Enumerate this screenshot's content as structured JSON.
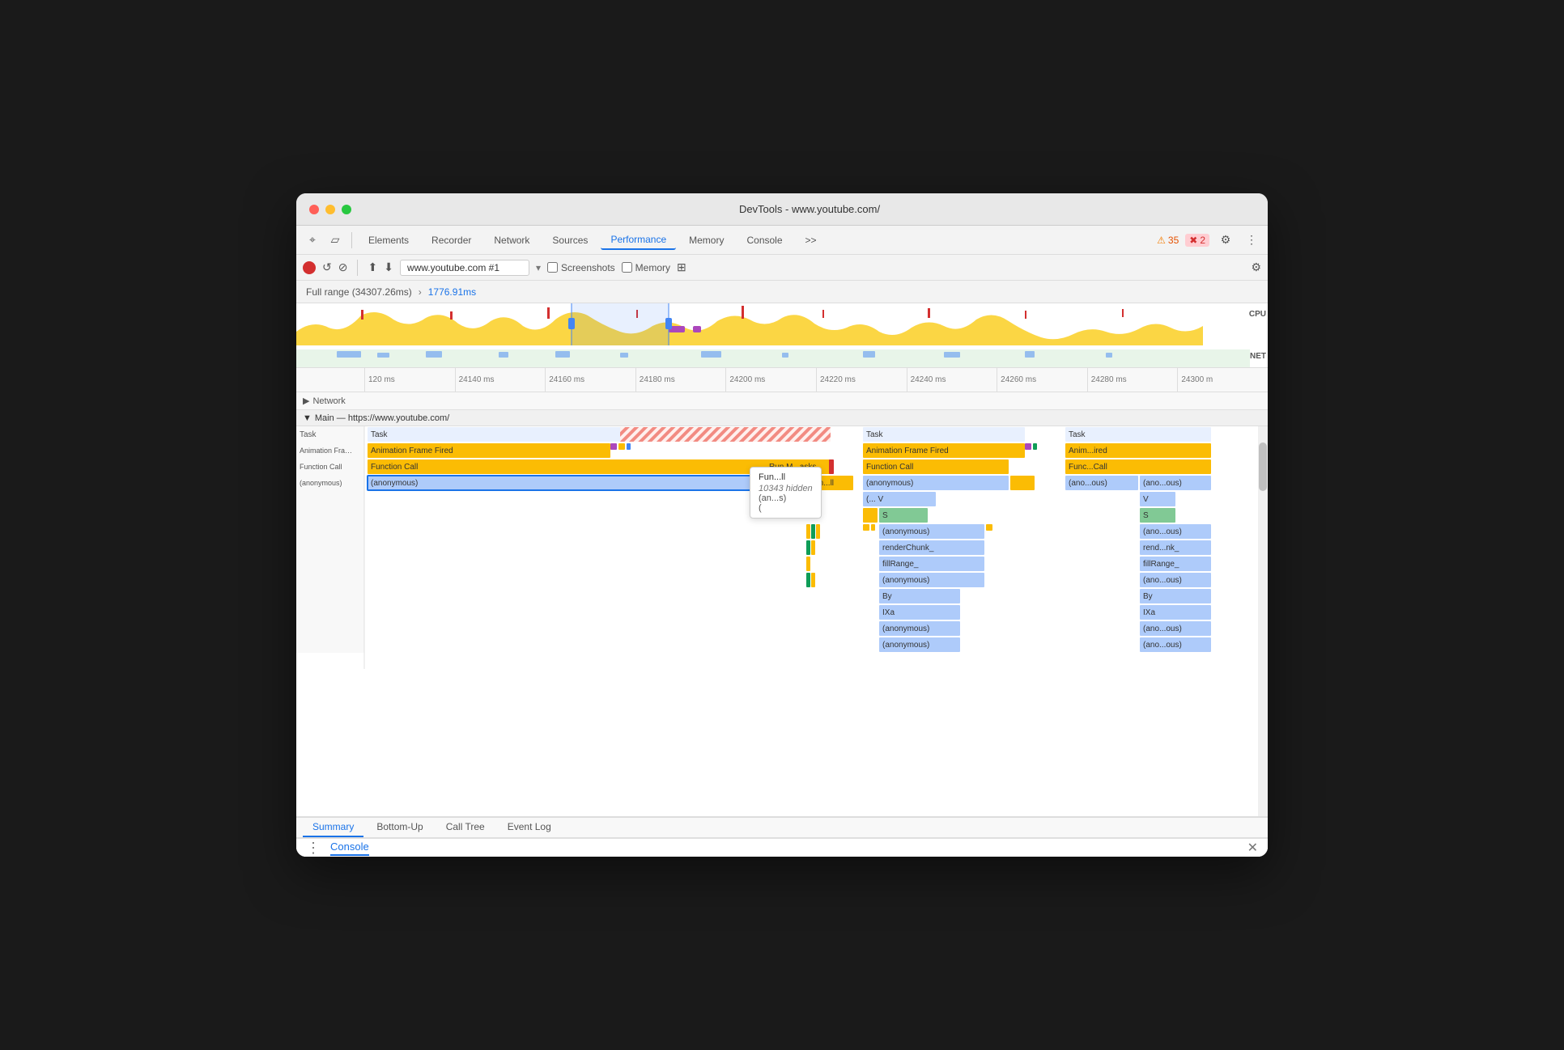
{
  "window": {
    "title": "DevTools - www.youtube.com/"
  },
  "toolbar": {
    "tabs": [
      "Elements",
      "Recorder",
      "Network",
      "Sources",
      "Performance",
      "Memory",
      "Console",
      "more"
    ],
    "active_tab": "Performance",
    "warn_count": "35",
    "error_count": "2"
  },
  "toolbar2": {
    "url": "www.youtube.com #1",
    "screenshots_label": "Screenshots",
    "memory_label": "Memory"
  },
  "range": {
    "full_range": "Full range (34307.26ms)",
    "selected": "1776.91ms",
    "chevron": "›"
  },
  "ruler": {
    "marks": [
      "120 ms",
      "24140 ms",
      "24160 ms",
      "24180 ms",
      "24200 ms",
      "24220 ms",
      "24240 ms",
      "24260 ms",
      "24280 ms",
      "24300 m"
    ]
  },
  "network_row": {
    "label": "Network"
  },
  "main": {
    "header": "Main — https://www.youtube.com/",
    "rows": [
      {
        "label": "Task",
        "items": [
          "Task",
          "Task"
        ]
      },
      {
        "label": "Animation Frame Fired",
        "items": [
          "Animation Frame Fired",
          "Animation Frame Fired",
          "Anim...ired"
        ]
      },
      {
        "label": "Function Call",
        "items": [
          "Function Call",
          "Run M...asks",
          "Function Call",
          "Func...Call"
        ]
      },
      {
        "label": "(anonymous)",
        "items": [
          "(anonymous)",
          "Fun...ll",
          "(anonymous)",
          "(anonymous)",
          "(ano...ous)",
          "(ano...ous)"
        ]
      },
      {
        "label": "",
        "items": [
          "10343 hidden"
        ]
      },
      {
        "label": "",
        "items": [
          "(an...s)",
          "(... V",
          "V"
        ]
      },
      {
        "label": "",
        "items": [
          "(...",
          "S",
          "S"
        ]
      },
      {
        "label": "",
        "items": [
          "(anonymous)",
          "(ano...ous)"
        ]
      },
      {
        "label": "",
        "items": [
          "renderChunk_",
          "rend...nk_"
        ]
      },
      {
        "label": "",
        "items": [
          "fillRange_",
          "fillRange_"
        ]
      },
      {
        "label": "",
        "items": [
          "(anonymous)",
          "(ano...ous)"
        ]
      },
      {
        "label": "",
        "items": [
          "By",
          "By"
        ]
      },
      {
        "label": "",
        "items": [
          "IXa",
          "IXa"
        ]
      },
      {
        "label": "",
        "items": [
          "(anonymous)",
          "(ano...ous)"
        ]
      },
      {
        "label": "",
        "items": [
          "(anonymous)",
          "(ano...ous)"
        ]
      }
    ]
  },
  "tooltip": {
    "header": "Fun...ll",
    "hidden_text": "10343 hidden",
    "sub1": "(an...s)",
    "sub2": "("
  },
  "bottom_tabs": {
    "tabs": [
      "Summary",
      "Bottom-Up",
      "Call Tree",
      "Event Log"
    ],
    "active": "Summary"
  },
  "console_bar": {
    "label": "Console",
    "dots": "⋮",
    "close": "✕"
  },
  "overview": {
    "cpu_label": "CPU",
    "net_label": "NET"
  }
}
